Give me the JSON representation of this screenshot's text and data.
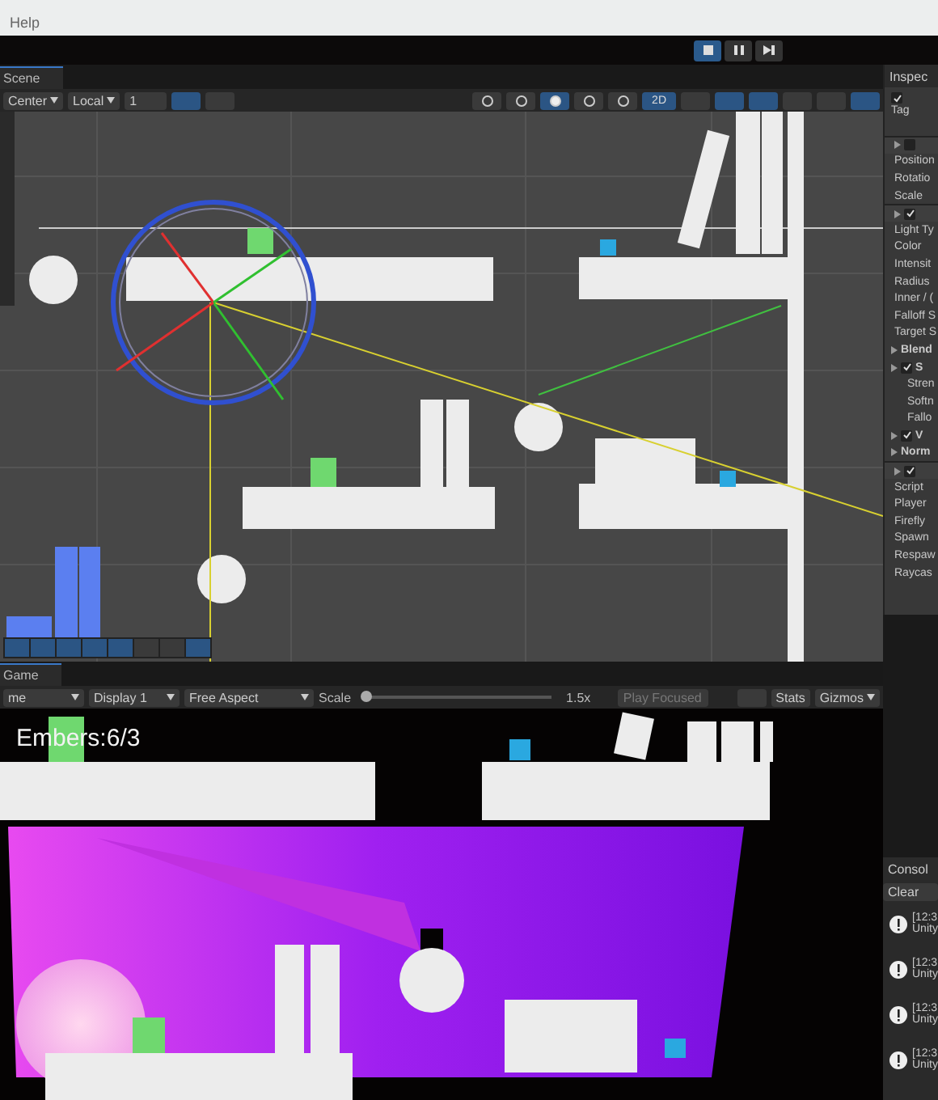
{
  "menu": {
    "items": [
      "Help"
    ]
  },
  "play_controls": [
    {
      "kind": "stop",
      "selected": true
    },
    {
      "kind": "pause",
      "selected": false
    },
    {
      "kind": "step",
      "selected": false
    }
  ],
  "scene": {
    "tab": "Scene",
    "pivot": "Center",
    "space": "Local",
    "snap": "1",
    "mode_2d": {
      "label": "2D",
      "selected": true
    }
  },
  "inspector": {
    "tab": "Inspec",
    "tag_label": "Tag",
    "active": true,
    "rows": [
      {
        "kind": "component",
        "text": "",
        "checked": false
      },
      {
        "kind": "field",
        "text": "Position"
      },
      {
        "kind": "field",
        "text": "Rotatio"
      },
      {
        "kind": "field",
        "text": "Scale"
      },
      {
        "kind": "component",
        "text": "",
        "checked": true
      },
      {
        "kind": "field",
        "text": "Light Ty"
      },
      {
        "kind": "field",
        "text": "Color"
      },
      {
        "kind": "field",
        "text": "Intensit"
      },
      {
        "kind": "field",
        "text": "Radius"
      },
      {
        "kind": "field",
        "text": "Inner / ("
      },
      {
        "kind": "field",
        "text": "Falloff S"
      },
      {
        "kind": "field",
        "text": "Target S"
      },
      {
        "kind": "foldout",
        "text": "Blend",
        "checked": null
      },
      {
        "kind": "foldout",
        "text": "S",
        "checked": true
      },
      {
        "kind": "subfield",
        "text": "Stren"
      },
      {
        "kind": "subfield",
        "text": "Softn"
      },
      {
        "kind": "subfield",
        "text": "Fallo"
      },
      {
        "kind": "foldout",
        "text": "V",
        "checked": true
      },
      {
        "kind": "foldout",
        "text": "Norm",
        "checked": null
      },
      {
        "kind": "component",
        "text": "",
        "checked": true
      },
      {
        "kind": "field",
        "text": "Script"
      },
      {
        "kind": "field",
        "text": "Player"
      },
      {
        "kind": "field",
        "text": "Firefly"
      },
      {
        "kind": "field",
        "text": "Spawn"
      },
      {
        "kind": "field",
        "text": "Respaw"
      },
      {
        "kind": "field",
        "text": "Raycas"
      }
    ]
  },
  "game": {
    "tab": "Game",
    "view": "me",
    "display": "Display 1",
    "aspect": "Free Aspect",
    "scale_label": "Scale",
    "scale": {
      "level": 0.0
    },
    "scale_value": "1.5x",
    "play_mode": "Play Focused",
    "stats": "Stats",
    "gizmos": "Gizmos",
    "hud": "Embers:6/3"
  },
  "console": {
    "tab": "Consol",
    "clear": "Clear",
    "messages": [
      {
        "time": "[12:3",
        "source": "Unity"
      },
      {
        "time": "[12:3",
        "source": "Unity"
      },
      {
        "time": "[12:3",
        "source": "Unity"
      },
      {
        "time": "[12:3",
        "source": "Unity"
      }
    ]
  }
}
